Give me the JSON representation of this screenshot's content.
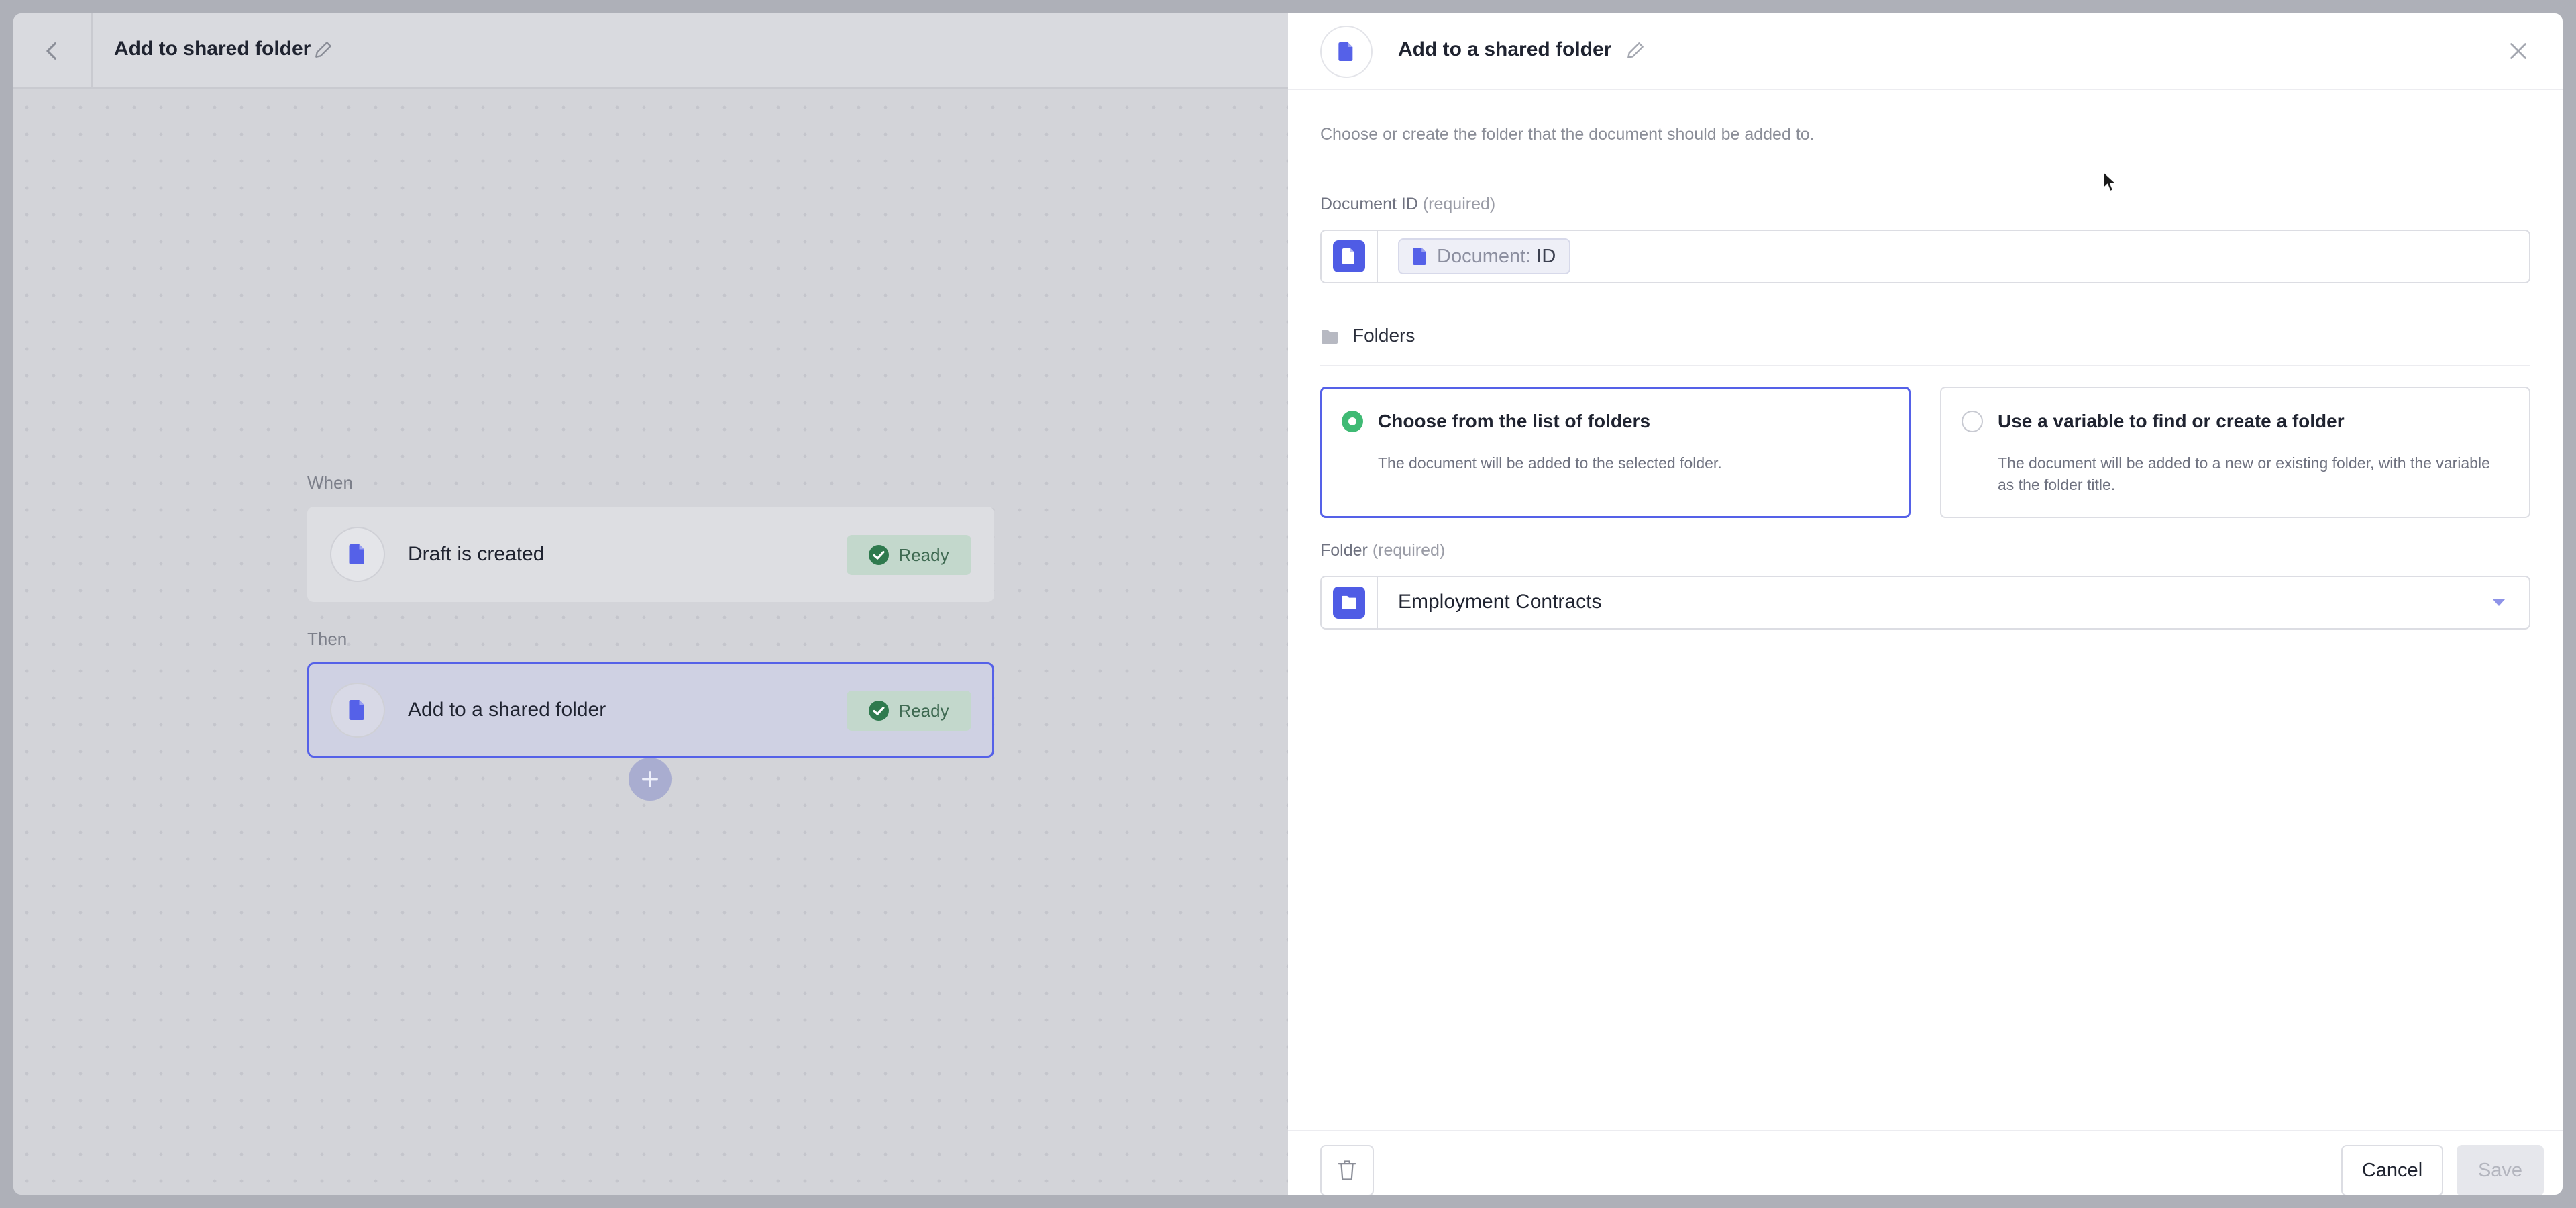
{
  "workflow": {
    "title": "Add to shared folder",
    "when_label": "When",
    "then_label": "Then",
    "steps": [
      {
        "label": "Draft is created",
        "status": "Ready",
        "icon": "document-icon"
      },
      {
        "label": "Add to a shared folder",
        "status": "Ready",
        "icon": "document-icon",
        "selected": true
      }
    ]
  },
  "panel": {
    "title": "Add to a shared folder",
    "description": "Choose or create the folder that the document should be added to.",
    "document_id": {
      "label": "Document ID",
      "required_label": "(required)",
      "token_prefix": "Document:",
      "token_value": "ID"
    },
    "folders_heading": "Folders",
    "options": [
      {
        "title": "Choose from the list of folders",
        "description": "The document will be added to the selected folder.",
        "selected": true
      },
      {
        "title": "Use a variable to find or create a folder",
        "description": "The document will be added to a new or existing folder, with the variable as the folder title.",
        "selected": false
      }
    ],
    "folder": {
      "label": "Folder",
      "required_label": "(required)",
      "value": "Employment Contracts"
    },
    "footer": {
      "cancel_label": "Cancel",
      "save_label": "Save"
    }
  },
  "colors": {
    "accent": "#5561e8",
    "success": "#3fba74",
    "badge_bg": "#c3d8cc"
  }
}
